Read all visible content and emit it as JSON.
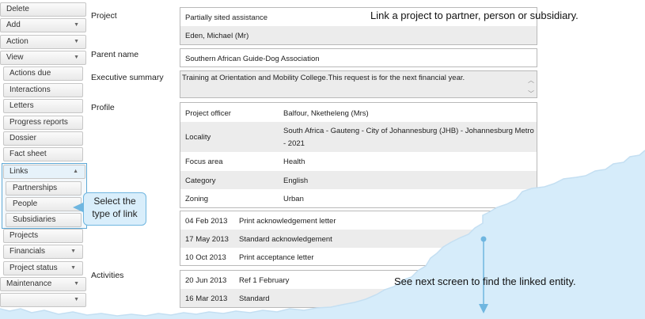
{
  "sidebar": {
    "items": [
      {
        "label": "Delete"
      },
      {
        "label": "Add"
      },
      {
        "label": "Action"
      },
      {
        "label": "View"
      },
      {
        "label": "Actions due"
      },
      {
        "label": "Interactions"
      },
      {
        "label": "Letters"
      },
      {
        "label": "Progress reports"
      },
      {
        "label": "Dossier"
      },
      {
        "label": "Fact sheet"
      },
      {
        "label": "Links"
      },
      {
        "label": "Partnerships"
      },
      {
        "label": "People"
      },
      {
        "label": "Subsidiaries"
      },
      {
        "label": "Projects"
      },
      {
        "label": "Financials"
      },
      {
        "label": "Project status"
      },
      {
        "label": "Maintenance"
      }
    ]
  },
  "callouts": {
    "select_link": "Select the type of link",
    "link_project": "Link a project to partner, person or subsidiary.",
    "next_screen": "See next screen to find the linked entity."
  },
  "project": {
    "label": "Project",
    "name": "Partially sited assistance",
    "contact": "Eden, Michael (Mr)"
  },
  "parent": {
    "label": "Parent name",
    "value": "Southern African Guide-Dog Association"
  },
  "summary": {
    "label": "Executive summary",
    "value": "Training at Orientation and Mobility College.This request is for the next financial year."
  },
  "profile": {
    "label": "Profile",
    "rows": [
      {
        "key": "Project officer",
        "value": "Balfour, Nketheleng (Mrs)"
      },
      {
        "key": "Locality",
        "value": "South Africa - Gauteng - City of Johannesburg (JHB) - Johannesburg Metro",
        "value2": "- 2021"
      },
      {
        "key": "Focus area",
        "value": "Health"
      },
      {
        "key": "Category",
        "value": "English"
      },
      {
        "key": "Zoning",
        "value": "Urban"
      }
    ]
  },
  "letters": [
    {
      "date": "04 Feb 2013",
      "text": "Print acknowledgement letter"
    },
    {
      "date": "17 May 2013",
      "text": "Standard acknowledgement"
    },
    {
      "date": "10 Oct 2013",
      "text": "Print acceptance letter"
    }
  ],
  "activities": {
    "label": "Activities",
    "rows": [
      {
        "date": "20 Jun 2013",
        "text": "Ref 1 February"
      },
      {
        "date": "16 Mar 2013",
        "text": "Standard"
      }
    ]
  },
  "colors": {
    "accent": "#5fa9d6",
    "callout_bg": "#d9eefb",
    "torn_bg": "#d6ecfa"
  }
}
